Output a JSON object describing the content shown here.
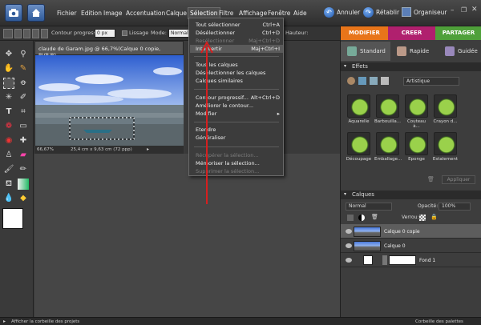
{
  "menubar": {
    "items": [
      "Fichier",
      "Edition",
      "Image",
      "Accentuation",
      "Calque",
      "Sélection",
      "Filtre",
      "Affichage",
      "Fenêtre",
      "Aide"
    ],
    "undo_label": "Annuler",
    "redo_label": "Rétablir",
    "organizer_label": "Organiseur"
  },
  "optionsbar": {
    "contour_label": "Contour progressif:",
    "contour_value": "0 px",
    "lissage_label": "Lissage",
    "mode_label": "Mode:",
    "mode_value": "Normal",
    "height_label": "Hauteur:"
  },
  "document": {
    "title": "claude de Garam.jpg @ 66,7%(Calque 0 copie, RVB/8)",
    "zoom": "66,67%",
    "dimensions": "25,4 cm x 9,63 cm (72 ppp)"
  },
  "selection_menu": {
    "items": [
      {
        "label": "Tout sélectionner",
        "shortcut": "Ctrl+A",
        "disabled": false
      },
      {
        "label": "Désélectionner",
        "shortcut": "Ctrl+D",
        "disabled": false
      },
      {
        "label": "Resélectionner",
        "shortcut": "Maj+Ctrl+D",
        "disabled": true
      },
      {
        "label": "Intervertir",
        "shortcut": "Maj+Ctrl+I",
        "disabled": false,
        "highlight": true
      },
      {
        "label": "Tous les calques",
        "shortcut": "",
        "disabled": false
      },
      {
        "label": "Désélectionner les calques",
        "shortcut": "",
        "disabled": false
      },
      {
        "label": "Calques similaires",
        "shortcut": "",
        "disabled": false
      },
      {
        "label": "Contour progressif...",
        "shortcut": "Alt+Ctrl+D",
        "disabled": false
      },
      {
        "label": "Améliorer le contour...",
        "shortcut": "",
        "disabled": false
      },
      {
        "label": "Modifier",
        "shortcut": "▸",
        "disabled": false
      },
      {
        "label": "Etendre",
        "shortcut": "",
        "disabled": false
      },
      {
        "label": "Généraliser",
        "shortcut": "",
        "disabled": false
      },
      {
        "label": "Récupérer la sélection...",
        "shortcut": "",
        "disabled": true
      },
      {
        "label": "Mémoriser la sélection...",
        "shortcut": "",
        "disabled": false
      },
      {
        "label": "Supprimer la sélection...",
        "shortcut": "",
        "disabled": true
      }
    ]
  },
  "rightpanel": {
    "tabs": [
      {
        "label": "MODIFIER",
        "color": "#e8751a"
      },
      {
        "label": "CREER",
        "color": "#b0206e"
      },
      {
        "label": "PARTAGER",
        "color": "#4fa03a"
      }
    ],
    "subtabs": [
      "Standard",
      "Rapide",
      "Guidée"
    ],
    "effects_header": "Effets",
    "effects_category": "Artistique",
    "effects": [
      "Aquarelle",
      "Barbouilla...",
      "Couteau à...",
      "Crayon d...",
      "Découpage",
      "Emballage...",
      "Eponge",
      "Estalement"
    ],
    "apply_label": "Appliquer",
    "layers_header": "Calques",
    "blend_mode": "Normal",
    "opacity_label": "Opacité:",
    "opacity_value": "100%",
    "lock_label": "Verrou:",
    "layers": [
      {
        "name": "Calque 0 copie",
        "selected": true
      },
      {
        "name": "Calque 0",
        "selected": false
      },
      {
        "name": "Fond 1",
        "selected": false
      }
    ]
  },
  "bottombar": {
    "left_label": "Afficher la corbeille des projets",
    "right_label": "Corbeille des palettes"
  },
  "colors": {
    "accent_red": "#d61f1f",
    "selection_highlight": "#5a5a5a"
  }
}
